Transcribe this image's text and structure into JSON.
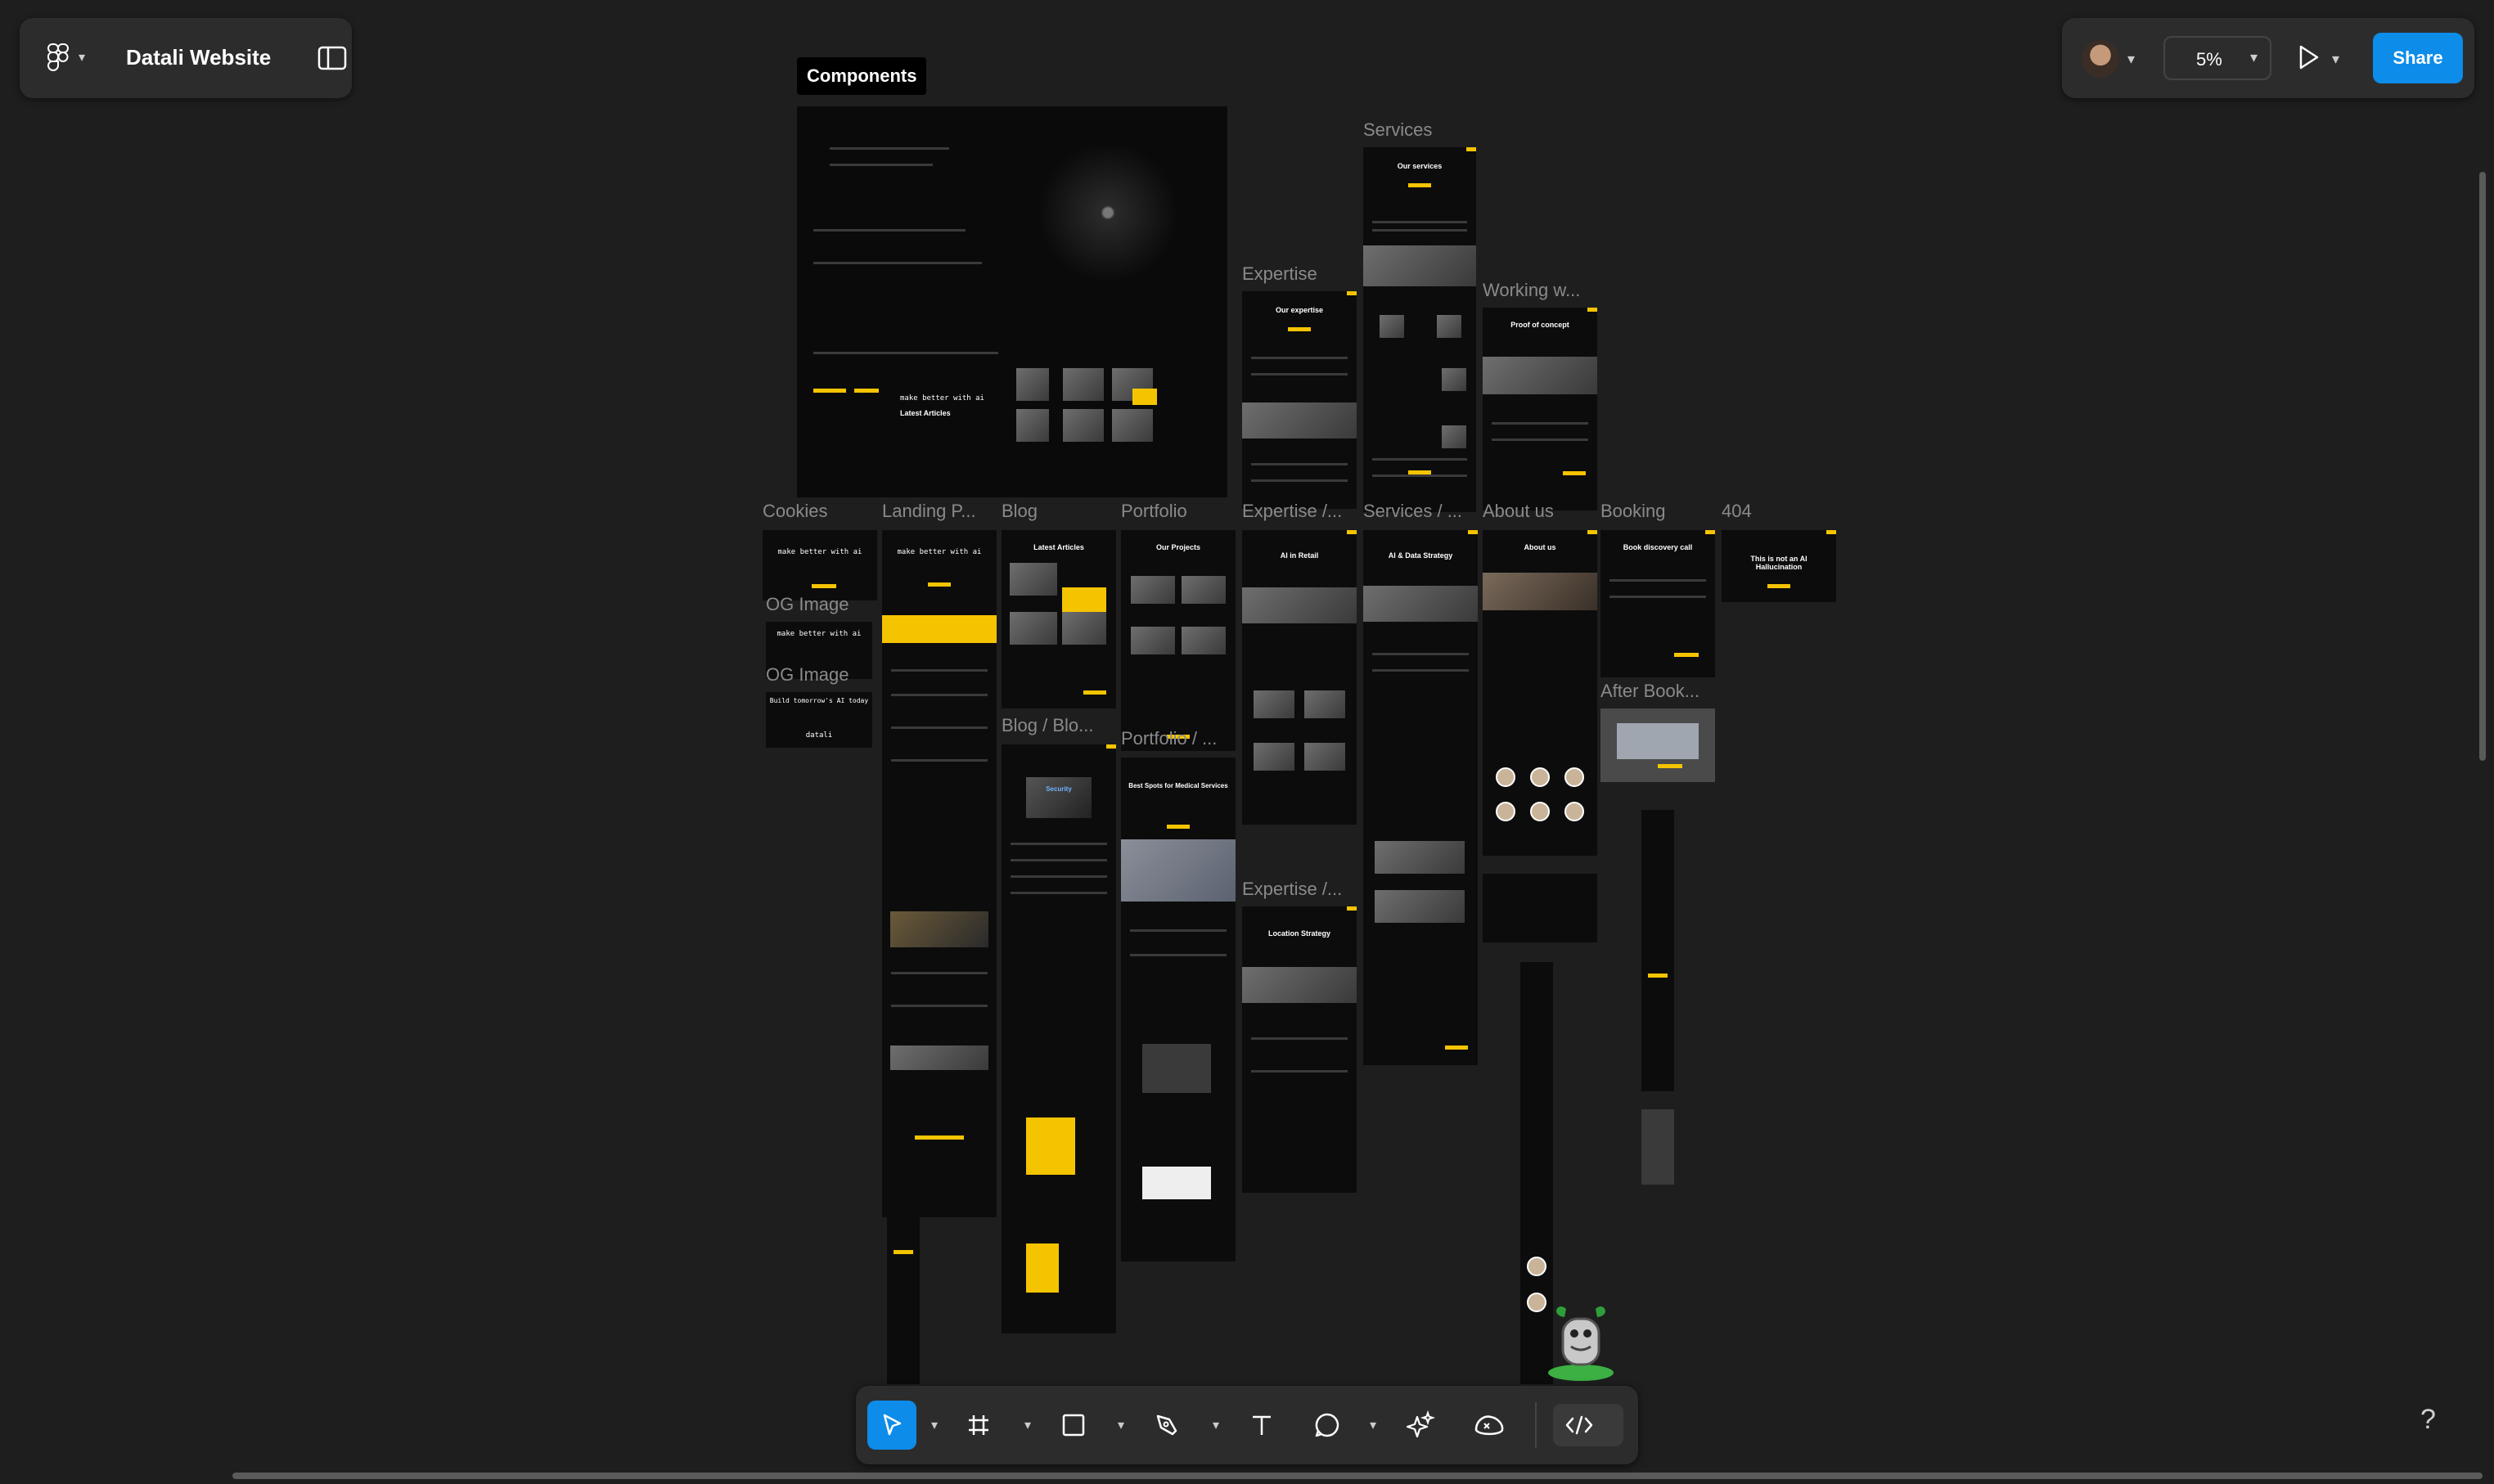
{
  "app": {
    "file_name": "Datali Website",
    "zoom": "5%",
    "share_label": "Share",
    "help_label": "?"
  },
  "canvas": {
    "components_tag": "Components",
    "frame_labels": {
      "services": "Services",
      "expertise": "Expertise",
      "working_with": "Working w...",
      "cookies": "Cookies",
      "landing": "Landing P...",
      "blog": "Blog",
      "portfolio": "Portfolio",
      "expertise_sub": "Expertise /...",
      "services_sub": "Services / ...",
      "about_us": "About us",
      "booking": "Booking",
      "notfound": "404",
      "og_image_1": "OG Image",
      "og_image_2": "OG Image",
      "blog_sub": "Blog / Blo...",
      "portfolio_sub": "Portfolio / ...",
      "after_booking": "After Book...",
      "expertise_sub2": "Expertise /..."
    },
    "frame_text": {
      "make_better": "make better with ai",
      "latest_articles": "Latest Articles",
      "our_projects": "Our Projects",
      "our_services": "Our services",
      "our_expertise": "Our expertise",
      "proof_of_concept": "Proof of concept",
      "ai_in_retail": "AI in Retail",
      "ai_data_strategy": "AI & Data Strategy",
      "about_us": "About us",
      "book_discovery": "Book discovery call",
      "not_hallucination": "This is not an AI Hallucination",
      "build_tomorrow": "Build tomorrow's AI today",
      "datali": "datali",
      "location_strategy": "Location Strategy",
      "best_spots": "Best Spots for Medical Services",
      "security": "Security"
    }
  },
  "toolbar": {
    "tools": [
      {
        "name": "move-tool",
        "icon": "pointer-icon",
        "active": true
      },
      {
        "name": "frame-tool",
        "icon": "hash-icon"
      },
      {
        "name": "shape-tool",
        "icon": "rectangle-icon"
      },
      {
        "name": "pen-tool",
        "icon": "pen-icon"
      },
      {
        "name": "text-tool",
        "icon": "text-icon"
      },
      {
        "name": "comment-tool",
        "icon": "comment-icon"
      },
      {
        "name": "actions-tool",
        "icon": "ai-sparkle-icon"
      },
      {
        "name": "resources-tool",
        "icon": "resources-icon"
      },
      {
        "name": "dev-mode-toggle",
        "icon": "code-icon"
      }
    ]
  },
  "colors": {
    "canvas_bg": "#1e1e1e",
    "panel_bg": "#2c2c2c",
    "accent": "#0d8ce9",
    "brand_yellow": "#f5c400",
    "frame_bg": "#0c0c0c"
  }
}
